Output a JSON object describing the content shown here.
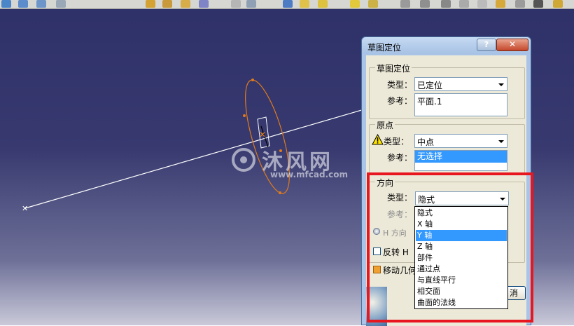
{
  "dialog": {
    "title": "草图定位",
    "help_button": "?",
    "close_button": "✕",
    "positioning": {
      "group_label": "草图定位",
      "type_label": "类型：",
      "type_value": "已定位",
      "reference_label": "参考：",
      "reference_value": "平面.1"
    },
    "origin": {
      "group_label": "原点",
      "type_label": "类型：",
      "type_value": "中点",
      "reference_label": "参考：",
      "reference_value": "无选择"
    },
    "orientation": {
      "group_label": "方向",
      "type_label": "类型：",
      "type_value": "隐式",
      "reference_label": "参考：",
      "h_direction_label": "H 方向",
      "reverse_h_label": "反转 H",
      "move_geometry_label": "移动几何",
      "options": [
        "隐式",
        "X 轴",
        "Y 轴",
        "Z 轴",
        "部件",
        "通过点",
        "与直线平行",
        "相交面",
        "曲面的法线"
      ],
      "highlighted_option": "Y 轴"
    },
    "cancel_button": "取消",
    "cancel_button_visible": "消"
  },
  "watermark": {
    "main": "沐风网",
    "sub": "www.mfcad.com"
  },
  "colors": {
    "background_top": "#2e3168",
    "sketch_color": "#e07a1a",
    "highlight": "#e8161f",
    "selection": "#3399ff"
  }
}
